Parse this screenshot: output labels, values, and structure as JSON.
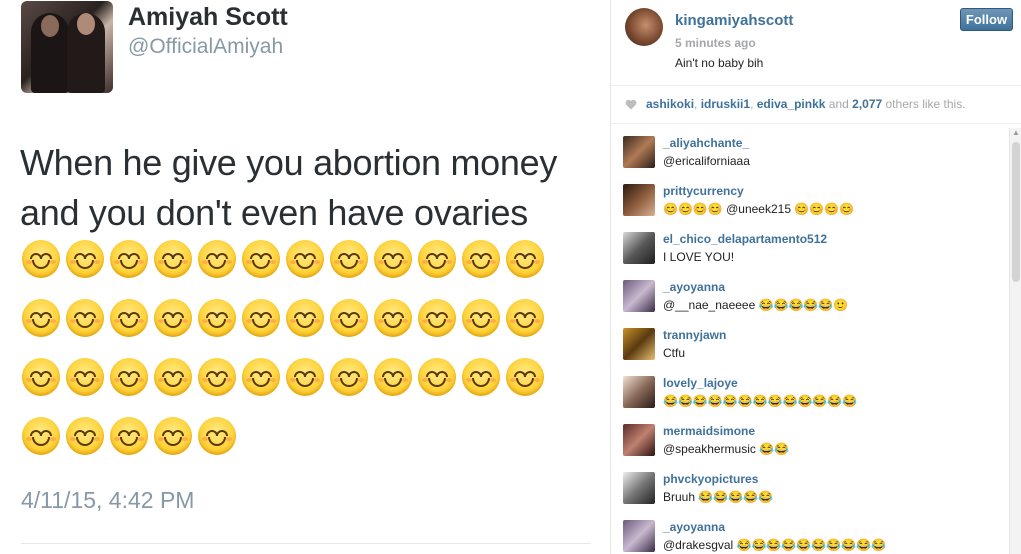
{
  "tweet": {
    "name": "Amiyah Scott",
    "handle": "@OfficialAmiyah",
    "text_line1": "When he give you abortion money",
    "text_line2": "and you don't even have ovaries",
    "emoji_icon": "smiling-face-with-smiling-eyes-icon",
    "emoji_count": 41,
    "timestamp": "4/11/15, 4:42 PM"
  },
  "instagram": {
    "username": "kingamiyahscott",
    "time_ago": "5 minutes ago",
    "caption": "Ain't no baby bih",
    "follow_label": "Follow",
    "likes": {
      "heart_icon": "heart-icon",
      "users": [
        "ashikoki",
        "idruskii1",
        "ediva_pinkk"
      ],
      "sep1": ", ",
      "sep2": ", ",
      "and_text": " and ",
      "count": "2,077",
      "suffix": " others like this."
    },
    "comments": [
      {
        "user": "_aliyahchante_",
        "text": "@ericaliforniaaa"
      },
      {
        "user": "prittycurrency",
        "text": "😊😊😊😊 @uneek215 😊😊😊😊"
      },
      {
        "user": "el_chico_delapartamento512",
        "text": "I LOVE YOU!"
      },
      {
        "user": "_ayoyanna",
        "text": "@__nae_naeeee 😂😂😂😂😂🙂"
      },
      {
        "user": "trannyjawn",
        "text": "Ctfu"
      },
      {
        "user": "lovely_lajoye",
        "text": "😂😂😂😂😂😂😂😂😂😂😂😂😂"
      },
      {
        "user": "mermaidsimone",
        "text": "@speakhermusic 😂😂"
      },
      {
        "user": "phvckyopictures",
        "text": "Bruuh 😂😂😂😂😂"
      },
      {
        "user": "_ayoyanna",
        "text": "@drakesgval 😂😂😂😂😂😂😂😂😂😂"
      }
    ]
  },
  "colors": {
    "ig_link": "#3f729b",
    "tweet_text": "#292f33",
    "tweet_meta": "#8899a6",
    "emoji_yellow": "#ffd43b"
  }
}
